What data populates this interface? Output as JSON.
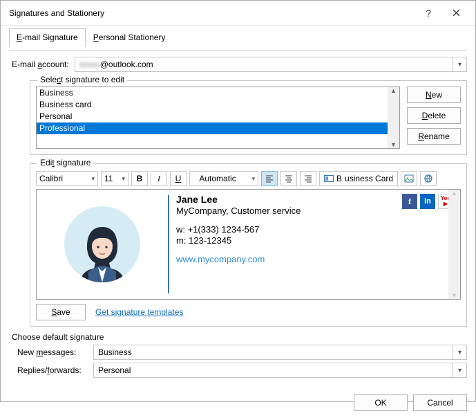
{
  "window": {
    "title": "Signatures and Stationery"
  },
  "tabs": {
    "email": "E-mail Signature",
    "stationery": "Personal Stationery"
  },
  "account": {
    "label_pre": "E-mail ",
    "label_u": "a",
    "label_post": "ccount:",
    "value_hidden": "xxxxx",
    "value_suffix": "@outlook.com"
  },
  "siglist": {
    "legend_pre": "Sele",
    "legend_u": "c",
    "legend_post": "t signature to edit",
    "items": [
      "Business",
      "Business card",
      "Personal",
      "Professional"
    ],
    "selected_index": 3
  },
  "sigbuttons": {
    "new_u": "N",
    "new_rest": "ew",
    "delete_u": "D",
    "delete_rest": "elete",
    "rename_u": "R",
    "rename_rest": "ename"
  },
  "editgroup": {
    "legend_pre": "Edi",
    "legend_u": "t",
    "legend_post": " signature"
  },
  "toolbar": {
    "font": "Calibri",
    "size": "11",
    "bold": "B",
    "italic": "I",
    "underline": "U",
    "color": "Automatic",
    "bizcard_u": "B",
    "bizcard_rest": "usiness Card"
  },
  "signature": {
    "name": "Jane Lee",
    "company": "MyCompany, Customer service",
    "phone_w": "w: +1(333) 1234-567",
    "phone_m": "m: 123-12345",
    "site": "www.mycompany.com"
  },
  "below": {
    "save_u": "S",
    "save_rest": "ave",
    "templates": "Get signature templates"
  },
  "defaults": {
    "legend": "Choose default signature",
    "new_pre": "New ",
    "new_u": "m",
    "new_post": "essages:",
    "new_value": "Business",
    "rep_pre": "Replies/",
    "rep_u": "f",
    "rep_post": "orwards:",
    "rep_value": "Personal"
  },
  "footer": {
    "ok": "OK",
    "cancel": "Cancel"
  }
}
